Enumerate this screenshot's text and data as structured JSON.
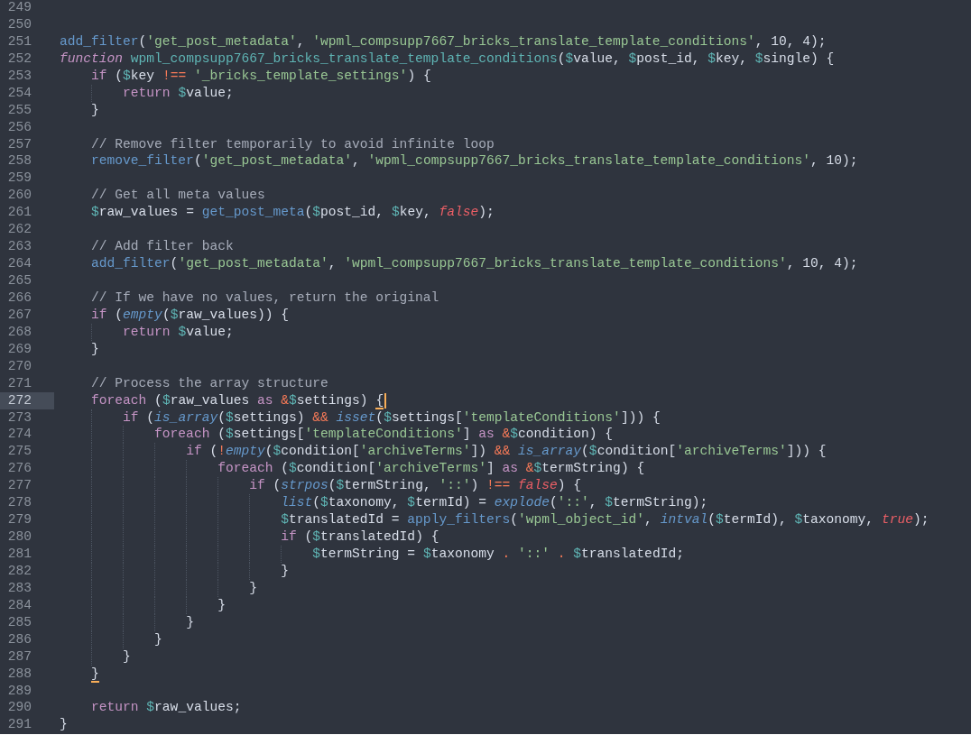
{
  "editor": {
    "lines": [
      {
        "number": "249",
        "current": false
      },
      {
        "number": "250",
        "current": false
      },
      {
        "number": "251",
        "current": false,
        "tokens": [
          {
            "kind": "call",
            "text": "add_filter"
          },
          {
            "kind": "plain",
            "text": "("
          },
          {
            "kind": "string",
            "text": "'get_post_metadata'"
          },
          {
            "kind": "plain",
            "text": ", "
          },
          {
            "kind": "string",
            "text": "'wpml_compsupp7667_bricks_translate_template_conditions'"
          },
          {
            "kind": "plain",
            "text": ", 10, 4);"
          }
        ]
      },
      {
        "number": "252",
        "current": false,
        "tokens": [
          {
            "kind": "storage",
            "text": "function "
          },
          {
            "kind": "name",
            "text": "wpml_compsupp7667_bricks_translate_template_conditions"
          },
          {
            "kind": "plain",
            "text": "("
          },
          {
            "kind": "var",
            "text": "$value"
          },
          {
            "kind": "plain",
            "text": ", "
          },
          {
            "kind": "var",
            "text": "$post_id"
          },
          {
            "kind": "plain",
            "text": ", "
          },
          {
            "kind": "var",
            "text": "$key"
          },
          {
            "kind": "plain",
            "text": ", "
          },
          {
            "kind": "var",
            "text": "$single"
          },
          {
            "kind": "plain",
            "text": ") {"
          }
        ]
      },
      {
        "number": "253",
        "current": false,
        "tokens": [
          {
            "kind": "keyword",
            "text": "    if"
          },
          {
            "kind": "plain",
            "text": " ("
          },
          {
            "kind": "var",
            "text": "$key "
          },
          {
            "kind": "op",
            "text": "!== "
          },
          {
            "kind": "string",
            "text": "'_bricks_template_settings'"
          },
          {
            "kind": "plain",
            "text": ") {"
          }
        ]
      },
      {
        "number": "254",
        "current": false,
        "tokens": [
          {
            "kind": "keyword",
            "text": "        return "
          },
          {
            "kind": "var",
            "text": "$value"
          },
          {
            "kind": "plain",
            "text": ";"
          }
        ]
      },
      {
        "number": "255",
        "current": false,
        "tokens": [
          {
            "kind": "plain",
            "text": "    }"
          }
        ]
      },
      {
        "number": "256",
        "current": false
      },
      {
        "number": "257",
        "current": false,
        "tokens": [
          {
            "kind": "comment",
            "text": "    // Remove filter temporarily to avoid infinite loop"
          }
        ]
      },
      {
        "number": "258",
        "current": false,
        "tokens": [
          {
            "kind": "call",
            "text": "    remove_filter"
          },
          {
            "kind": "plain",
            "text": "("
          },
          {
            "kind": "string",
            "text": "'get_post_metadata'"
          },
          {
            "kind": "plain",
            "text": ", "
          },
          {
            "kind": "string",
            "text": "'wpml_compsupp7667_bricks_translate_template_conditions'"
          },
          {
            "kind": "plain",
            "text": ", 10);"
          }
        ]
      },
      {
        "number": "259",
        "current": false
      },
      {
        "number": "260",
        "current": false,
        "tokens": [
          {
            "kind": "comment",
            "text": "    // Get all meta values"
          }
        ]
      },
      {
        "number": "261",
        "current": false,
        "tokens": [
          {
            "kind": "var",
            "text": "    $raw_values"
          },
          {
            "kind": "plain",
            "text": " = "
          },
          {
            "kind": "call",
            "text": "get_post_meta"
          },
          {
            "kind": "plain",
            "text": "("
          },
          {
            "kind": "var",
            "text": "$post_id"
          },
          {
            "kind": "plain",
            "text": ", "
          },
          {
            "kind": "var",
            "text": "$key"
          },
          {
            "kind": "plain",
            "text": ", "
          },
          {
            "kind": "const",
            "text": "false"
          },
          {
            "kind": "plain",
            "text": ");"
          }
        ]
      },
      {
        "number": "262",
        "current": false
      },
      {
        "number": "263",
        "current": false,
        "tokens": [
          {
            "kind": "comment",
            "text": "    // Add filter back"
          }
        ]
      },
      {
        "number": "264",
        "current": false,
        "tokens": [
          {
            "kind": "call",
            "text": "    add_filter"
          },
          {
            "kind": "plain",
            "text": "("
          },
          {
            "kind": "string",
            "text": "'get_post_metadata'"
          },
          {
            "kind": "plain",
            "text": ", "
          },
          {
            "kind": "string",
            "text": "'wpml_compsupp7667_bricks_translate_template_conditions'"
          },
          {
            "kind": "plain",
            "text": ", 10, 4);"
          }
        ]
      },
      {
        "number": "265",
        "current": false
      },
      {
        "number": "266",
        "current": false,
        "tokens": [
          {
            "kind": "comment",
            "text": "    // If we have no values, return the original"
          }
        ]
      },
      {
        "number": "267",
        "current": false,
        "tokens": [
          {
            "kind": "keyword",
            "text": "    if"
          },
          {
            "kind": "plain",
            "text": " ("
          },
          {
            "kind": "builtin",
            "text": "empty"
          },
          {
            "kind": "plain",
            "text": "("
          },
          {
            "kind": "var",
            "text": "$raw_values"
          },
          {
            "kind": "plain",
            "text": ")) {"
          }
        ]
      },
      {
        "number": "268",
        "current": false,
        "tokens": [
          {
            "kind": "keyword",
            "text": "        return "
          },
          {
            "kind": "var",
            "text": "$value"
          },
          {
            "kind": "plain",
            "text": ";"
          }
        ]
      },
      {
        "number": "269",
        "current": false,
        "tokens": [
          {
            "kind": "plain",
            "text": "    }"
          }
        ]
      },
      {
        "number": "270",
        "current": false
      },
      {
        "number": "271",
        "current": false,
        "tokens": [
          {
            "kind": "comment",
            "text": "    // Process the array structure"
          }
        ]
      },
      {
        "number": "272",
        "current": true,
        "tokens": [
          {
            "kind": "keyword",
            "text": "    foreach"
          },
          {
            "kind": "plain",
            "text": " ("
          },
          {
            "kind": "var",
            "text": "$raw_values "
          },
          {
            "kind": "keyword",
            "text": "as "
          },
          {
            "kind": "op",
            "text": "&"
          },
          {
            "kind": "var",
            "text": "$settings"
          },
          {
            "kind": "plain",
            "text": ") "
          },
          {
            "kind": "bracket",
            "text": "{"
          }
        ]
      },
      {
        "number": "273",
        "current": false,
        "tokens": [
          {
            "kind": "keyword",
            "text": "        if"
          },
          {
            "kind": "plain",
            "text": " ("
          },
          {
            "kind": "builtin",
            "text": "is_array"
          },
          {
            "kind": "plain",
            "text": "("
          },
          {
            "kind": "var",
            "text": "$settings"
          },
          {
            "kind": "plain",
            "text": ") "
          },
          {
            "kind": "op",
            "text": "&& "
          },
          {
            "kind": "builtin",
            "text": "isset"
          },
          {
            "kind": "plain",
            "text": "("
          },
          {
            "kind": "var",
            "text": "$settings"
          },
          {
            "kind": "plain",
            "text": "["
          },
          {
            "kind": "string",
            "text": "'templateConditions'"
          },
          {
            "kind": "plain",
            "text": "])) {"
          }
        ]
      },
      {
        "number": "274",
        "current": false,
        "tokens": [
          {
            "kind": "keyword",
            "text": "            foreach"
          },
          {
            "kind": "plain",
            "text": " ("
          },
          {
            "kind": "var",
            "text": "$settings"
          },
          {
            "kind": "plain",
            "text": "["
          },
          {
            "kind": "string",
            "text": "'templateConditions'"
          },
          {
            "kind": "plain",
            "text": "] "
          },
          {
            "kind": "keyword",
            "text": "as "
          },
          {
            "kind": "op",
            "text": "&"
          },
          {
            "kind": "var",
            "text": "$condition"
          },
          {
            "kind": "plain",
            "text": ") {"
          }
        ]
      },
      {
        "number": "275",
        "current": false,
        "tokens": [
          {
            "kind": "keyword",
            "text": "                if"
          },
          {
            "kind": "plain",
            "text": " ("
          },
          {
            "kind": "op",
            "text": "!"
          },
          {
            "kind": "builtin",
            "text": "empty"
          },
          {
            "kind": "plain",
            "text": "("
          },
          {
            "kind": "var",
            "text": "$condition"
          },
          {
            "kind": "plain",
            "text": "["
          },
          {
            "kind": "string",
            "text": "'archiveTerms'"
          },
          {
            "kind": "plain",
            "text": "]) "
          },
          {
            "kind": "op",
            "text": "&& "
          },
          {
            "kind": "builtin",
            "text": "is_array"
          },
          {
            "kind": "plain",
            "text": "("
          },
          {
            "kind": "var",
            "text": "$condition"
          },
          {
            "kind": "plain",
            "text": "["
          },
          {
            "kind": "string",
            "text": "'archiveTerms'"
          },
          {
            "kind": "plain",
            "text": "])) {"
          }
        ]
      },
      {
        "number": "276",
        "current": false,
        "tokens": [
          {
            "kind": "keyword",
            "text": "                    foreach"
          },
          {
            "kind": "plain",
            "text": " ("
          },
          {
            "kind": "var",
            "text": "$condition"
          },
          {
            "kind": "plain",
            "text": "["
          },
          {
            "kind": "string",
            "text": "'archiveTerms'"
          },
          {
            "kind": "plain",
            "text": "] "
          },
          {
            "kind": "keyword",
            "text": "as "
          },
          {
            "kind": "op",
            "text": "&"
          },
          {
            "kind": "var",
            "text": "$termString"
          },
          {
            "kind": "plain",
            "text": ") {"
          }
        ]
      },
      {
        "number": "277",
        "current": false,
        "tokens": [
          {
            "kind": "keyword",
            "text": "                        if"
          },
          {
            "kind": "plain",
            "text": " ("
          },
          {
            "kind": "builtin",
            "text": "strpos"
          },
          {
            "kind": "plain",
            "text": "("
          },
          {
            "kind": "var",
            "text": "$termString"
          },
          {
            "kind": "plain",
            "text": ", "
          },
          {
            "kind": "string",
            "text": "'::'"
          },
          {
            "kind": "plain",
            "text": ") "
          },
          {
            "kind": "op",
            "text": "!== "
          },
          {
            "kind": "const",
            "text": "false"
          },
          {
            "kind": "plain",
            "text": ") {"
          }
        ]
      },
      {
        "number": "278",
        "current": false,
        "tokens": [
          {
            "kind": "builtin",
            "text": "                            list"
          },
          {
            "kind": "plain",
            "text": "("
          },
          {
            "kind": "var",
            "text": "$taxonomy"
          },
          {
            "kind": "plain",
            "text": ", "
          },
          {
            "kind": "var",
            "text": "$termId"
          },
          {
            "kind": "plain",
            "text": ") = "
          },
          {
            "kind": "builtin",
            "text": "explode"
          },
          {
            "kind": "plain",
            "text": "("
          },
          {
            "kind": "string",
            "text": "'::'"
          },
          {
            "kind": "plain",
            "text": ", "
          },
          {
            "kind": "var",
            "text": "$termString"
          },
          {
            "kind": "plain",
            "text": ");"
          }
        ]
      },
      {
        "number": "279",
        "current": false,
        "tokens": [
          {
            "kind": "var",
            "text": "                            $translatedId"
          },
          {
            "kind": "plain",
            "text": " = "
          },
          {
            "kind": "call",
            "text": "apply_filters"
          },
          {
            "kind": "plain",
            "text": "("
          },
          {
            "kind": "string",
            "text": "'wpml_object_id'"
          },
          {
            "kind": "plain",
            "text": ", "
          },
          {
            "kind": "builtin",
            "text": "intval"
          },
          {
            "kind": "plain",
            "text": "("
          },
          {
            "kind": "var",
            "text": "$termId"
          },
          {
            "kind": "plain",
            "text": "), "
          },
          {
            "kind": "var",
            "text": "$taxonomy"
          },
          {
            "kind": "plain",
            "text": ", "
          },
          {
            "kind": "const",
            "text": "true"
          },
          {
            "kind": "plain",
            "text": ");"
          }
        ]
      },
      {
        "number": "280",
        "current": false,
        "tokens": [
          {
            "kind": "keyword",
            "text": "                            if"
          },
          {
            "kind": "plain",
            "text": " ("
          },
          {
            "kind": "var",
            "text": "$translatedId"
          },
          {
            "kind": "plain",
            "text": ") {"
          }
        ]
      },
      {
        "number": "281",
        "current": false,
        "tokens": [
          {
            "kind": "var",
            "text": "                                $termString"
          },
          {
            "kind": "plain",
            "text": " = "
          },
          {
            "kind": "var",
            "text": "$taxonomy "
          },
          {
            "kind": "op",
            "text": ". "
          },
          {
            "kind": "string",
            "text": "'::' "
          },
          {
            "kind": "op",
            "text": ". "
          },
          {
            "kind": "var",
            "text": "$translatedId"
          },
          {
            "kind": "plain",
            "text": ";"
          }
        ]
      },
      {
        "number": "282",
        "current": false,
        "tokens": [
          {
            "kind": "plain",
            "text": "                            }"
          }
        ]
      },
      {
        "number": "283",
        "current": false,
        "tokens": [
          {
            "kind": "plain",
            "text": "                        }"
          }
        ]
      },
      {
        "number": "284",
        "current": false,
        "tokens": [
          {
            "kind": "plain",
            "text": "                    }"
          }
        ]
      },
      {
        "number": "285",
        "current": false,
        "tokens": [
          {
            "kind": "plain",
            "text": "                }"
          }
        ]
      },
      {
        "number": "286",
        "current": false,
        "tokens": [
          {
            "kind": "plain",
            "text": "            }"
          }
        ]
      },
      {
        "number": "287",
        "current": false,
        "tokens": [
          {
            "kind": "plain",
            "text": "        }"
          }
        ]
      },
      {
        "number": "288",
        "current": false,
        "tokens": [
          {
            "kind": "bracket",
            "text": "    }"
          }
        ]
      },
      {
        "number": "289",
        "current": false
      },
      {
        "number": "290",
        "current": false,
        "tokens": [
          {
            "kind": "keyword",
            "text": "    return "
          },
          {
            "kind": "var",
            "text": "$raw_values"
          },
          {
            "kind": "plain",
            "text": ";"
          }
        ]
      },
      {
        "number": "291",
        "current": false,
        "tokens": [
          {
            "kind": "plain",
            "text": "}"
          }
        ]
      }
    ]
  }
}
